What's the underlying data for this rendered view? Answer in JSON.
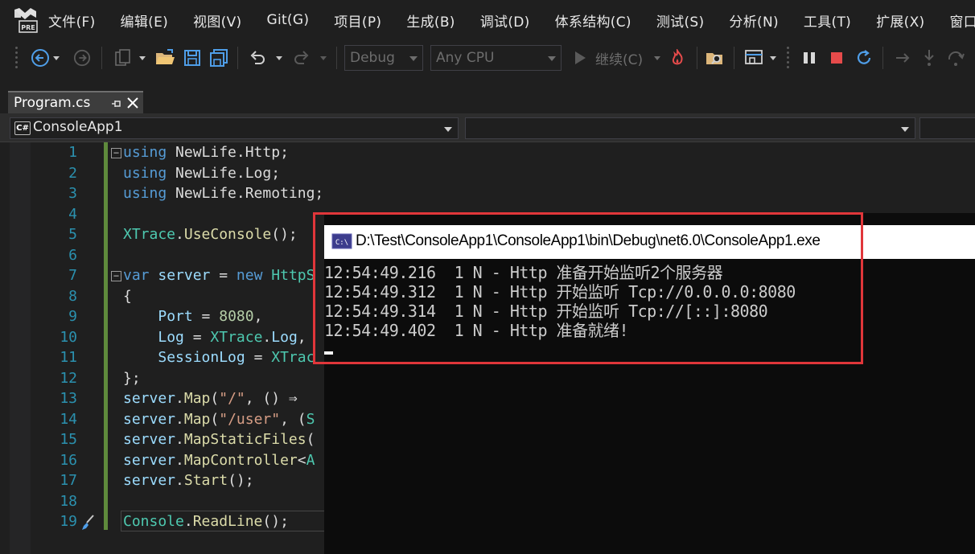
{
  "menubar": {
    "items": [
      "文件(F)",
      "编辑(E)",
      "视图(V)",
      "Git(G)",
      "项目(P)",
      "生成(B)",
      "调试(D)",
      "体系结构(C)",
      "测试(S)",
      "分析(N)",
      "工具(T)",
      "扩展(X)",
      "窗口"
    ],
    "logo_badge": "PRE"
  },
  "toolbar": {
    "configuration": "Debug",
    "platform": "Any CPU",
    "continue_label": "继续(C)"
  },
  "tabs": [
    {
      "label": "Program.cs"
    }
  ],
  "navbar": {
    "project_icon": "C#",
    "project": "ConsoleApp1"
  },
  "editor": {
    "line_numbers": [
      "1",
      "2",
      "3",
      "4",
      "5",
      "6",
      "7",
      "8",
      "9",
      "10",
      "11",
      "12",
      "13",
      "14",
      "15",
      "16",
      "17",
      "18",
      "19"
    ]
  },
  "console": {
    "title": "D:\\Test\\ConsoleApp1\\ConsoleApp1\\bin\\Debug\\net6.0\\ConsoleApp1.exe",
    "icon_text": "C:\\",
    "lines": [
      "12:54:49.216  1 N - Http 准备开始监听2个服务器",
      "12:54:49.312  1 N - Http 开始监听 Tcp://0.0.0.0:8080",
      "12:54:49.314  1 N - Http 开始监听 Tcp://[::]:8080",
      "12:54:49.402  1 N - Http 准备就绪!"
    ]
  },
  "colors": {
    "keyword": "#569cd6",
    "type": "#4ec9b0",
    "method": "#dcdcaa",
    "line_number": "#2b91af",
    "highlight_border": "#e0363a"
  }
}
